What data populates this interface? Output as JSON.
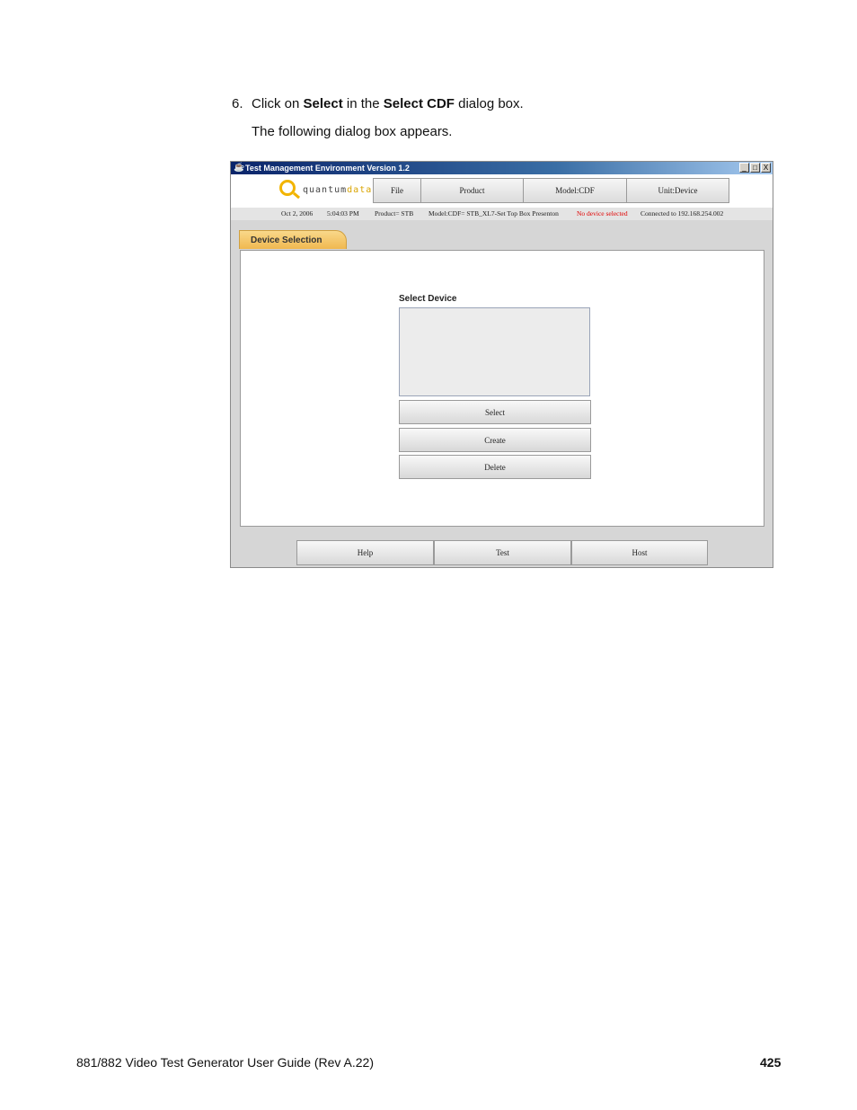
{
  "instruction": {
    "number": "6.",
    "part1": "Click on ",
    "bold1": "Select",
    "part2": " in the ",
    "bold2": "Select CDF",
    "part3": " dialog box."
  },
  "subtext": "The following dialog box appears.",
  "window": {
    "title": "Test Management Environment Version 1.2",
    "controls": {
      "minimize": "_",
      "maximize": "□",
      "close": "X"
    },
    "logo": {
      "text_main": "quantum",
      "text_accent": "data"
    },
    "menu": [
      "File",
      "Product",
      "Model:CDF",
      "Unit:Device"
    ],
    "status": {
      "date": "Oct 2, 2006",
      "time": "5:04:03 PM",
      "product": "Product= STB",
      "model": "Model:CDF= STB_XL7-Set Top Box Presenton",
      "device": "No device selected",
      "connection": "Connected to 192.168.254.002"
    },
    "tab_label": "Device Selection",
    "select_label": "Select Device",
    "actions": [
      "Select",
      "Create",
      "Delete"
    ],
    "bottom_buttons": [
      "Help",
      "Test",
      "Host"
    ]
  },
  "footer": {
    "left": "881/882 Video Test Generator User Guide (Rev A.22)",
    "page": "425"
  },
  "colors": {
    "status_alert": "#e00000",
    "tab": "#f0b850",
    "logo_accent": "#f2b400"
  }
}
